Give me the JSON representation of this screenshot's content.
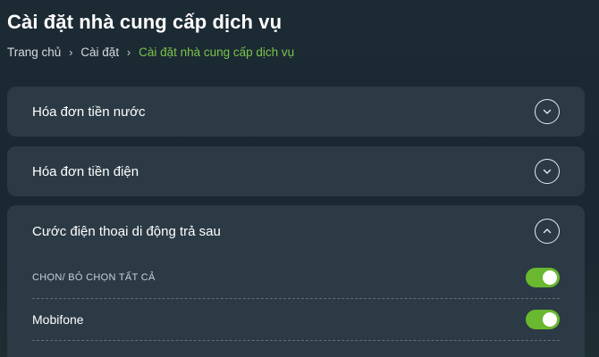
{
  "page": {
    "title": "Cài đặt nhà cung cấp dịch vụ"
  },
  "breadcrumb": {
    "items": [
      "Trang chủ",
      "Cài đặt",
      "Cài đặt nhà cung cấp dịch vụ"
    ],
    "separator": "›"
  },
  "accordions": [
    {
      "title": "Hóa đơn tiền nước",
      "expanded": false,
      "icon": "chevron-down-icon"
    },
    {
      "title": "Hóa đơn tiền điện",
      "expanded": false,
      "icon": "chevron-down-icon"
    },
    {
      "title": "Cước điện thoại di động trả sau",
      "expanded": true,
      "icon": "chevron-up-icon",
      "options": [
        {
          "label": "CHỌN/ BỎ CHỌN TẤT CẢ",
          "checked": true
        },
        {
          "label": "Mobifone",
          "checked": true
        }
      ]
    }
  ],
  "colors": {
    "accent": "#6ab82f",
    "breadcrumb_active": "#7bc54a",
    "card_bg": "#2c3c46",
    "page_bg": "#1c2a34"
  }
}
